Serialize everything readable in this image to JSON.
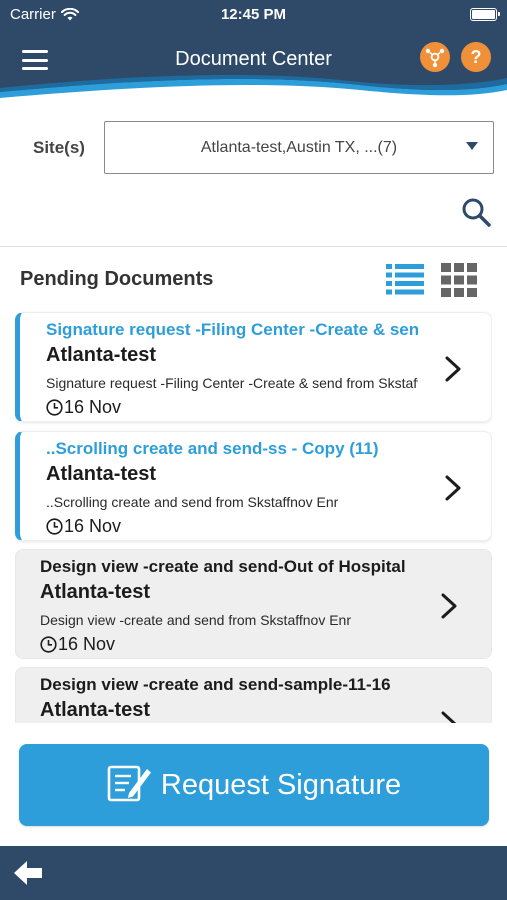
{
  "status_bar": {
    "carrier": "Carrier",
    "time": "12:45 PM"
  },
  "header": {
    "title": "Document Center",
    "menu_icon": "hamburger-menu-icon",
    "site_icon": "sites-network-icon",
    "help_icon": "help-icon",
    "help_glyph": "?"
  },
  "filter": {
    "label": "Site(s)",
    "value": "Atlanta-test,Austin TX, ...(7)"
  },
  "section": {
    "title": "Pending Documents",
    "list_view_icon": "list-view-icon",
    "grid_view_icon": "grid-view-icon"
  },
  "documents": [
    {
      "subject": "Signature request -Filing Center -Create & send from Skstaffnov",
      "site": "Atlanta-test",
      "description": "Signature request -Filing Center -Create & send from Skstaffnov Enr",
      "date": "16 Nov",
      "state": "pending"
    },
    {
      "subject": "..Scrolling create and send-ss - Copy (11)",
      "site": "Atlanta-test",
      "description": "..Scrolling create and send from Skstaffnov Enr",
      "date": "16 Nov",
      "state": "pending"
    },
    {
      "subject": "Design view -create and send-Out of Hospital",
      "site": "Atlanta-test",
      "description": "Design view -create and send from Skstaffnov Enr",
      "date": "16 Nov",
      "state": "viewed"
    },
    {
      "subject": "Design view -create and send-sample-11-16",
      "site": "Atlanta-test",
      "description": "",
      "date": "",
      "state": "viewed"
    }
  ],
  "actions": {
    "request_signature": "Request Signature"
  },
  "colors": {
    "navy": "#2f4a69",
    "accent_blue": "#2d9ed9",
    "orange": "#f0913a"
  }
}
